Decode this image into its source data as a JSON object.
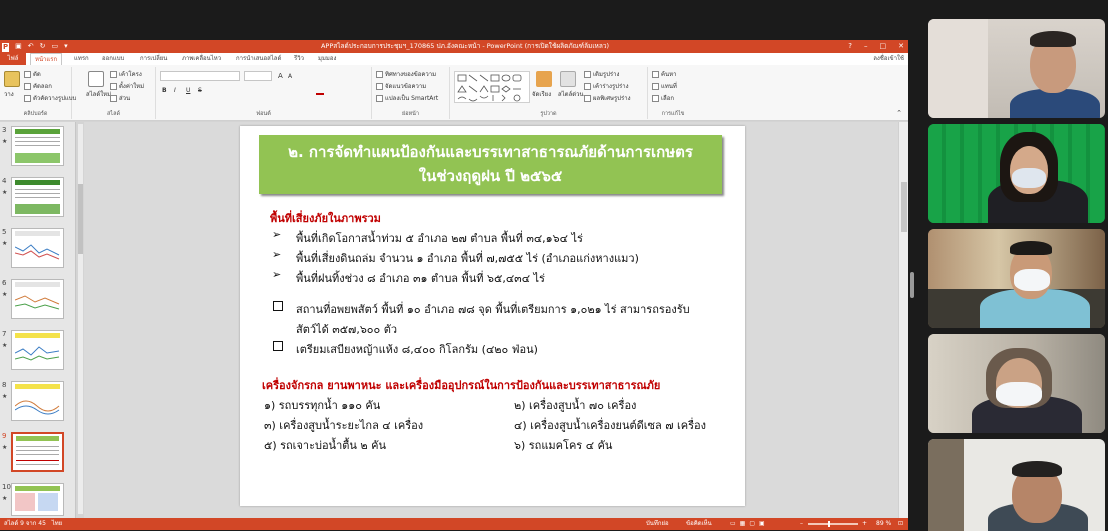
{
  "titlebar": {
    "title": "APPสไลด์ประกอบการประชุมฯ_170865 ปภ.อังคณะหน้า - PowerPoint (การเปิดใช้ผลิตภัณฑ์ล้มเหลว)",
    "help": "?",
    "minimize": "–",
    "maximize": "□",
    "close": "✕"
  },
  "tabs": [
    "ไฟล์",
    "หน้าแรก",
    "แทรก",
    "ออกแบบ",
    "การเปลี่ยน",
    "ภาพเคลื่อนไหว",
    "การนำเสนอสไลด์",
    "รีวิว",
    "มุมมอง"
  ],
  "signin": "ลงชื่อเข้าใช้",
  "ribbon": {
    "clipboard": {
      "label": "คลิปบอร์ด",
      "paste": "วาง",
      "cut": "ตัด",
      "copy": "คัดลอก",
      "format": "ตัวคัดวางรูปแบบ"
    },
    "slides": {
      "label": "สไลด์",
      "new": "สไลด์ใหม่",
      "layout": "เค้าโครง",
      "reset": "ตั้งค่าใหม่",
      "section": "ส่วน"
    },
    "font": {
      "label": "ฟอนต์",
      "bold": "B",
      "italic": "I",
      "underline": "U",
      "strike": "S",
      "size_up": "A",
      "size_down": "A"
    },
    "paragraph": {
      "label": "ย่อหน้า",
      "direction": "ทิศทางของข้อความ",
      "align": "จัดแนวข้อความ",
      "smartart": "แปลงเป็น SmartArt"
    },
    "drawing": {
      "label": "รูปวาด",
      "arrange": "จัดเรียง",
      "quick": "สไตล์ด่วน",
      "fill": "เติมรูปร่าง",
      "outline": "เค้าร่างรูปร่าง",
      "effects": "ผลพิเศษรูปร่าง"
    },
    "editing": {
      "label": "การแก้ไข",
      "find": "ค้นหา",
      "replace": "แทนที่",
      "select": "เลือก"
    }
  },
  "thumbnails": [
    {
      "num": "3",
      "star": "★"
    },
    {
      "num": "4",
      "star": "★"
    },
    {
      "num": "5",
      "star": "★"
    },
    {
      "num": "6",
      "star": "★"
    },
    {
      "num": "7",
      "star": "★"
    },
    {
      "num": "8",
      "star": "★"
    },
    {
      "num": "9",
      "star": "★"
    },
    {
      "num": "10",
      "star": "★"
    }
  ],
  "slide": {
    "header_line1": "๒. การจัดทำแผนป้องกันและบรรเทาสาธารณภัยด้านการเกษตร",
    "header_line2": "ในช่วงฤดูฝน ปี ๒๕๖๕",
    "risk_heading": "พื้นที่เสี่ยงภัยในภาพรวม",
    "bullets": [
      "พื้นที่เกิดโอกาสน้ำท่วม ๕ อำเภอ ๒๗ ตำบล พื้นที่ ๓๔,๑๖๔ ไร่",
      "พื้นที่เสี่ยงดินถล่ม จำนวน ๑ อำเภอ พื้นที่ ๗,๗๕๕ ไร่ (อำเภอแก่งหางแมว)",
      "พื้นที่ฝนทิ้งช่วง ๘ อำเภอ ๓๑ ตำบล พื้นที่ ๖๕,๔๓๔ ไร่"
    ],
    "shelter_line1": "สถานที่อพยพสัตว์ พื้นที่ ๑๐ อำเภอ ๗๘ จุด  พื้นที่เตรียมการ ๑,๐๒๑ ไร่ สามารถรองรับ",
    "shelter_line2": "สัตว์ได้ ๓๕๗,๖๐๐ ตัว",
    "hay": "เตรียมเสบียงหญ้าแห้ง ๘,๔๐๐ กิโลกรัม (๔๒๐ ฟ่อน)",
    "equip_heading": "เครื่องจักรกล ยานพาหนะ และเครื่องมืออุปกรณ์ในการป้องกันและบรรเทาสาธารณภัย",
    "equip_left": [
      "๑) รถบรรทุกน้ำ   ๑๑๐ คัน",
      "๓) เครื่องสูบน้ำระยะไกล ๔ เครื่อง",
      "๕) รถเจาะบ่อน้ำตื้น ๒ คัน"
    ],
    "equip_right": [
      "๒) เครื่องสูบน้ำ   ๗๐ เครื่อง",
      "๔) เครื่องสูบน้ำเครื่องยนต์ดีเซล  ๗ เครื่อง",
      "๖) รถแมคโคร ๔ คัน"
    ]
  },
  "statusbar": {
    "slide_info": "สไลด์ 9 จาก 45",
    "lang": "ไทย",
    "notes": "บันทึกย่อ",
    "comments": "ข้อคิดเห็น",
    "zoom": "89 %"
  },
  "colors": {
    "accent": "#d24726",
    "header_green": "#92c353",
    "heading_red": "#c00000"
  }
}
